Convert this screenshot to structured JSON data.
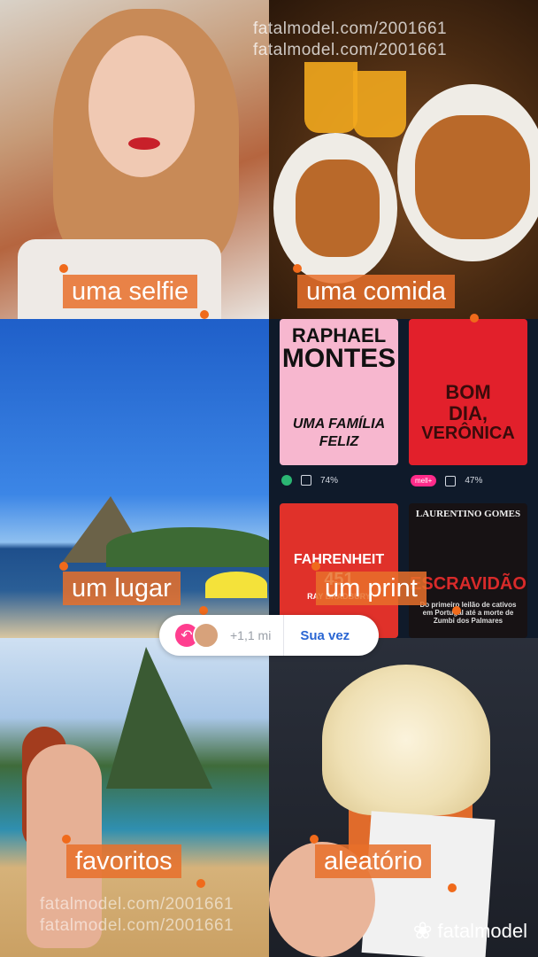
{
  "watermarks": {
    "top_1": "fatalmodel.com/2001661",
    "top_2": "fatalmodel.com/2001661",
    "bottom_1": "fatalmodel.com/2001661",
    "bottom_2": "fatalmodel.com/2001661"
  },
  "tiles": {
    "selfie": "uma selfie",
    "comida": "uma comida",
    "lugar": "um lugar",
    "print": "um print",
    "favoritos": "favoritos",
    "aleatorio": "aleatório"
  },
  "books": [
    {
      "title_1": "RAPHAEL",
      "title_2": "MONTES",
      "title_3": "UMA FAMÍLIA",
      "title_4": "FELIZ",
      "progress": "74%"
    },
    {
      "title_1": "BOM",
      "title_2": "DIA,",
      "title_3": "VERÔNICA",
      "progress": "47%",
      "badge": "mell+"
    },
    {
      "title_1": "FAHRENHEIT",
      "title_2": "451",
      "author": "RAY BRADBURY"
    },
    {
      "title_1": "LAURENTINO GOMES",
      "title_2": "ESCRAVIDÃO",
      "subtitle": "Do primeiro leilão de cativos em Portugal até a morte de Zumbi dos Palmares"
    }
  ],
  "reply_bar": {
    "count": "+1,1 mi",
    "action": "Sua vez"
  },
  "brand": {
    "name": "fatalmodel"
  },
  "colors": {
    "label_bg": "#e8702a",
    "accent_pink": "#ff3e8f",
    "action_blue": "#2a66d3"
  }
}
